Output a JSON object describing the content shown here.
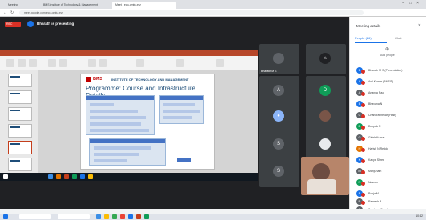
{
  "browser": {
    "tabs": [
      "Meeting",
      "BMS Institute of Technology & Management",
      "Meet - eco-qmtu-xyz"
    ],
    "url": "meet.google.com/eco-qmtu-xyz"
  },
  "meet": {
    "rec_label": "REC",
    "presenter_text": "Bharath is presenting"
  },
  "slide": {
    "logo": "BMS",
    "institute": "INSTITUTE OF TECHNOLOGY AND MANAGEMENT",
    "title": "Programme: Course and Infrastructure Details"
  },
  "tiles": [
    {
      "initial": "",
      "name": "Bharath M S",
      "color": "#5f6368"
    },
    {
      "initial": "⌂",
      "name": "",
      "color": "#202124"
    },
    {
      "initial": "A",
      "name": "",
      "color": "#5f6368"
    },
    {
      "initial": "D",
      "name": "",
      "color": "#0f9d58"
    },
    {
      "initial": "●",
      "name": "",
      "color": "#8ab4f8"
    },
    {
      "initial": "",
      "name": "",
      "color": "#795548"
    },
    {
      "initial": "S",
      "name": "",
      "color": "#5f6368"
    },
    {
      "initial": "",
      "name": "",
      "color": "#e8eaed"
    },
    {
      "initial": "S",
      "name": "",
      "color": "#5f6368"
    }
  ],
  "panel": {
    "title": "Meeting details",
    "tab_people": "People (26)",
    "tab_chat": "Chat",
    "add_label": "Add people"
  },
  "people": [
    {
      "initial": "B",
      "color": "#1a73e8",
      "name": "Bharath M S (Presentation)"
    },
    {
      "initial": "A",
      "color": "#1a73e8",
      "name": "Anil Kumar (BMSIT)"
    },
    {
      "initial": "A",
      "color": "#5f6368",
      "name": "Ananya Rao"
    },
    {
      "initial": "B",
      "color": "#1a73e8",
      "name": "Bhavana N"
    },
    {
      "initial": "C",
      "color": "#5f6368",
      "name": "Chandrashekar (Host)"
    },
    {
      "initial": "D",
      "color": "#0f9d58",
      "name": "Deepak R"
    },
    {
      "initial": "G",
      "color": "#5f6368",
      "name": "Girish Kumar"
    },
    {
      "initial": "H",
      "color": "#e37400",
      "name": "Harish N Reddy"
    },
    {
      "initial": "K",
      "color": "#1a73e8",
      "name": "Kavya Shree"
    },
    {
      "initial": "M",
      "color": "#5f6368",
      "name": "Manjunath"
    },
    {
      "initial": "N",
      "color": "#0f9d58",
      "name": "Naveen"
    },
    {
      "initial": "P",
      "color": "#1a73e8",
      "name": "Pooja M"
    },
    {
      "initial": "R",
      "color": "#5f6368",
      "name": "Ramesh B"
    },
    {
      "initial": "S",
      "color": "#5f6368",
      "name": "Sandeep Gowda"
    }
  ],
  "clock": "10:42"
}
